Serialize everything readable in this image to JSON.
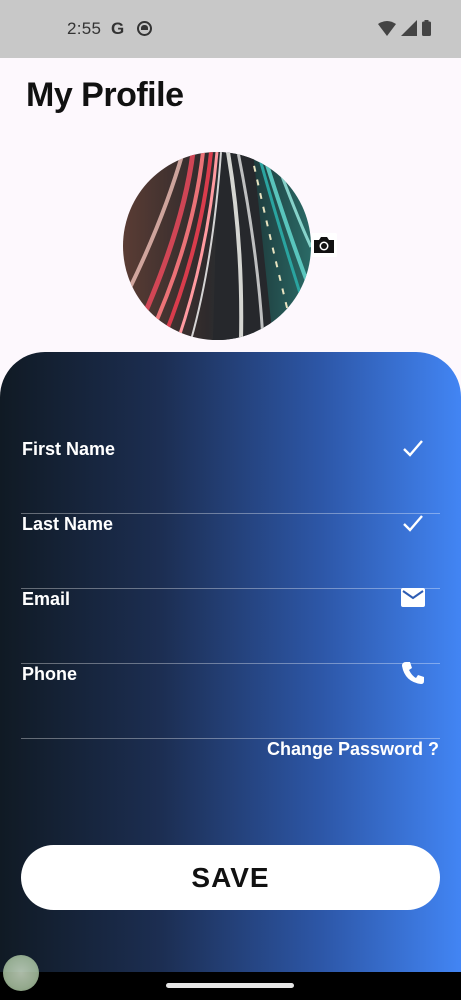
{
  "status_bar": {
    "time": "2:55",
    "google_glyph": "G"
  },
  "page": {
    "title": "My Profile"
  },
  "form": {
    "fields": [
      {
        "label": "First Name",
        "icon": "check-icon"
      },
      {
        "label": "Last Name",
        "icon": "check-icon"
      },
      {
        "label": "Email",
        "icon": "mail-icon"
      },
      {
        "label": "Phone",
        "icon": "phone-icon"
      }
    ],
    "change_password": "Change Password ?",
    "save_label": "SAVE"
  },
  "colors": {
    "gradient_start": "#101a24",
    "gradient_end": "#4285f4",
    "background": "#fdf8fd"
  }
}
